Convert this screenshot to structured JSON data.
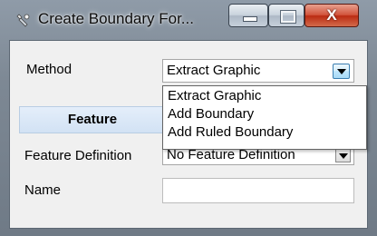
{
  "window": {
    "title": "Create Boundary For...",
    "controls": {
      "close_glyph": "X"
    },
    "icon": "wrench-gear-icon"
  },
  "form": {
    "method_label": "Method",
    "method_value": "Extract Graphic",
    "feature_tab_label": "Feature",
    "feature_definition_label": "Feature Definition",
    "feature_definition_value": "No Feature Definition",
    "name_label": "Name",
    "name_value": ""
  },
  "method_dropdown": {
    "options": [
      "Extract Graphic",
      "Add Boundary",
      "Add Ruled Boundary"
    ]
  }
}
